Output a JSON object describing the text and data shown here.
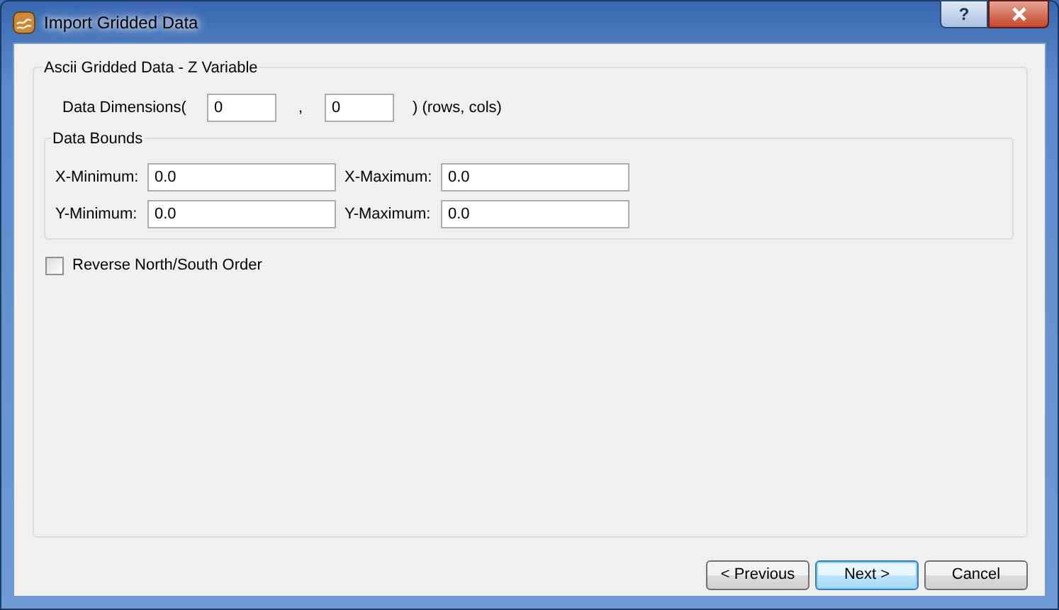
{
  "window": {
    "title": "Import Gridded Data",
    "help_button": "?"
  },
  "group": {
    "title": "Ascii Gridded Data - Z Variable",
    "dimensions": {
      "label": "Data Dimensions(",
      "rows": "0",
      "separator": ",",
      "cols": "0",
      "suffix": ") (rows, cols)"
    },
    "bounds": {
      "title": "Data Bounds",
      "fields": [
        {
          "label": "X-Minimum:",
          "value": "0.0"
        },
        {
          "label": "X-Maximum:",
          "value": "0.0"
        },
        {
          "label": "Y-Minimum:",
          "value": "0.0"
        },
        {
          "label": "Y-Maximum:",
          "value": "0.0"
        }
      ]
    },
    "reverse": {
      "label": "Reverse North/South Order",
      "checked": false
    }
  },
  "buttons": [
    {
      "label": "< Previous",
      "default": false
    },
    {
      "label": "Next >",
      "default": true
    },
    {
      "label": "Cancel",
      "default": false
    }
  ]
}
